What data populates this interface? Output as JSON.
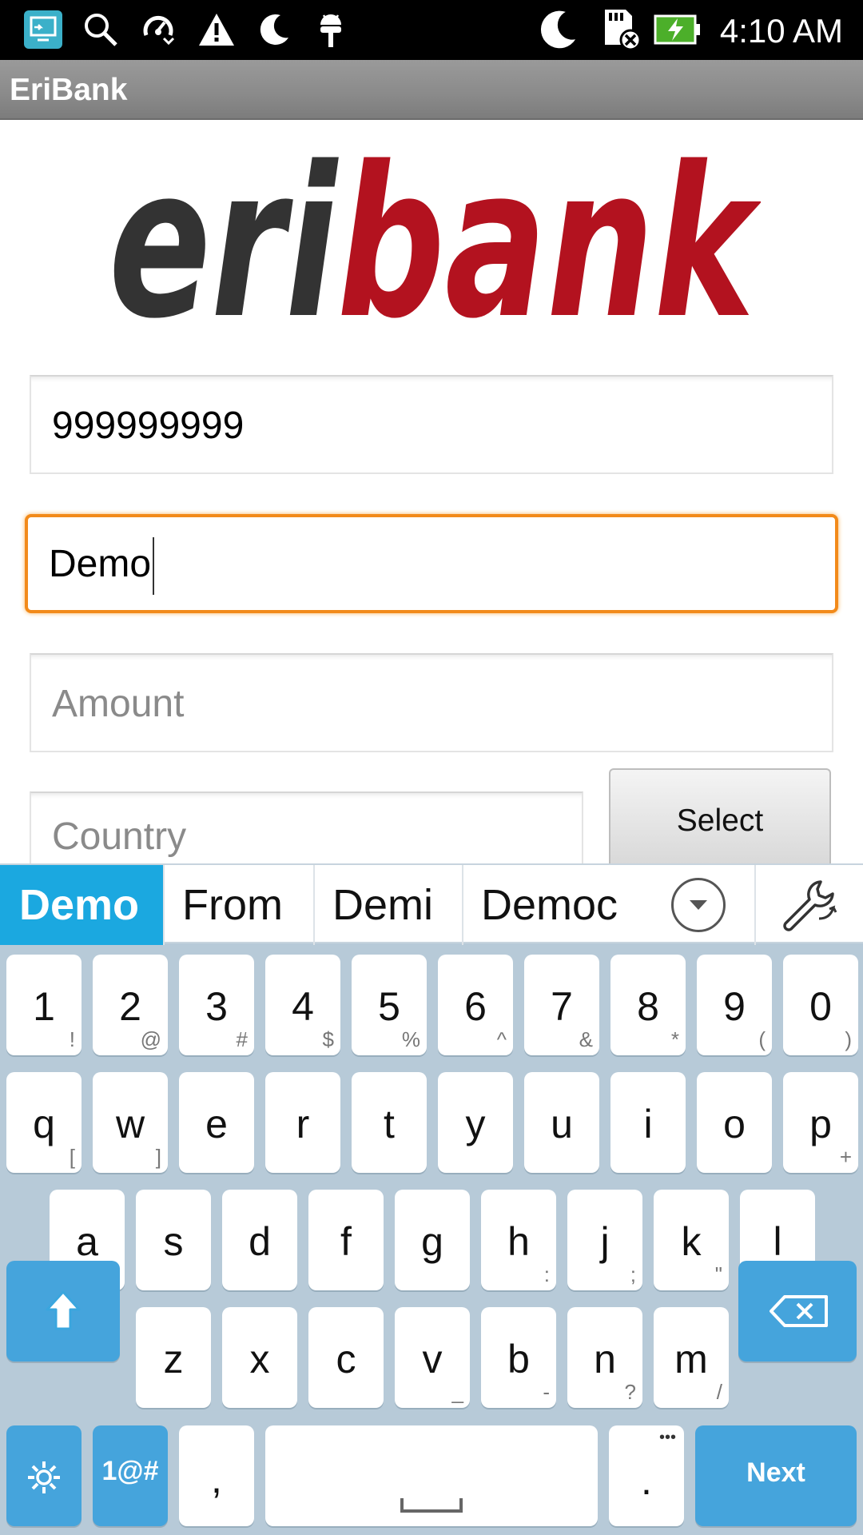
{
  "status_bar": {
    "time": "4:10 AM",
    "icons": [
      "screen-mirror-icon",
      "search-icon",
      "data-saver-icon",
      "warning-icon",
      "moon-icon",
      "android-debug-icon",
      "moon-icon",
      "no-sd-card-icon",
      "battery-charging-icon"
    ]
  },
  "action_bar": {
    "title": "EriBank"
  },
  "logo": {
    "text_dark": "eri",
    "text_red": "bank",
    "dark_color": "#333333",
    "red_color": "#b3121f"
  },
  "form": {
    "account_value": "999999999",
    "name_value": "Demo",
    "amount_placeholder": "Amount",
    "country_placeholder": "Country",
    "select_label": "Select",
    "focus_color": "#f28a1a"
  },
  "keyboard": {
    "suggestions": [
      "Demo",
      "From",
      "Demi",
      "Democ"
    ],
    "accent_color": "#1ba8e0",
    "row1": [
      {
        "main": "1",
        "sub": "!"
      },
      {
        "main": "2",
        "sub": "@"
      },
      {
        "main": "3",
        "sub": "#"
      },
      {
        "main": "4",
        "sub": "$"
      },
      {
        "main": "5",
        "sub": "%"
      },
      {
        "main": "6",
        "sub": "^"
      },
      {
        "main": "7",
        "sub": "&"
      },
      {
        "main": "8",
        "sub": "*"
      },
      {
        "main": "9",
        "sub": "("
      },
      {
        "main": "0",
        "sub": ")"
      }
    ],
    "row2": [
      {
        "main": "q",
        "sub": "["
      },
      {
        "main": "w",
        "sub": "]"
      },
      {
        "main": "e",
        "sub": ""
      },
      {
        "main": "r",
        "sub": ""
      },
      {
        "main": "t",
        "sub": ""
      },
      {
        "main": "y",
        "sub": ""
      },
      {
        "main": "u",
        "sub": ""
      },
      {
        "main": "i",
        "sub": ""
      },
      {
        "main": "o",
        "sub": ""
      },
      {
        "main": "p",
        "sub": "+"
      }
    ],
    "row3": [
      {
        "main": "a",
        "sub": ""
      },
      {
        "main": "s",
        "sub": ""
      },
      {
        "main": "d",
        "sub": ""
      },
      {
        "main": "f",
        "sub": ""
      },
      {
        "main": "g",
        "sub": ""
      },
      {
        "main": "h",
        "sub": ":"
      },
      {
        "main": "j",
        "sub": ";"
      },
      {
        "main": "k",
        "sub": "\""
      },
      {
        "main": "l",
        "sub": "'"
      }
    ],
    "row4": [
      {
        "main": "z",
        "sub": ""
      },
      {
        "main": "x",
        "sub": ""
      },
      {
        "main": "c",
        "sub": ""
      },
      {
        "main": "v",
        "sub": "_"
      },
      {
        "main": "b",
        "sub": "-"
      },
      {
        "main": "n",
        "sub": "?"
      },
      {
        "main": "m",
        "sub": "/"
      }
    ],
    "symbols_label": "1@#",
    "comma_label": ",",
    "period_label": ".",
    "period_more": "•••",
    "next_label": "Next"
  }
}
